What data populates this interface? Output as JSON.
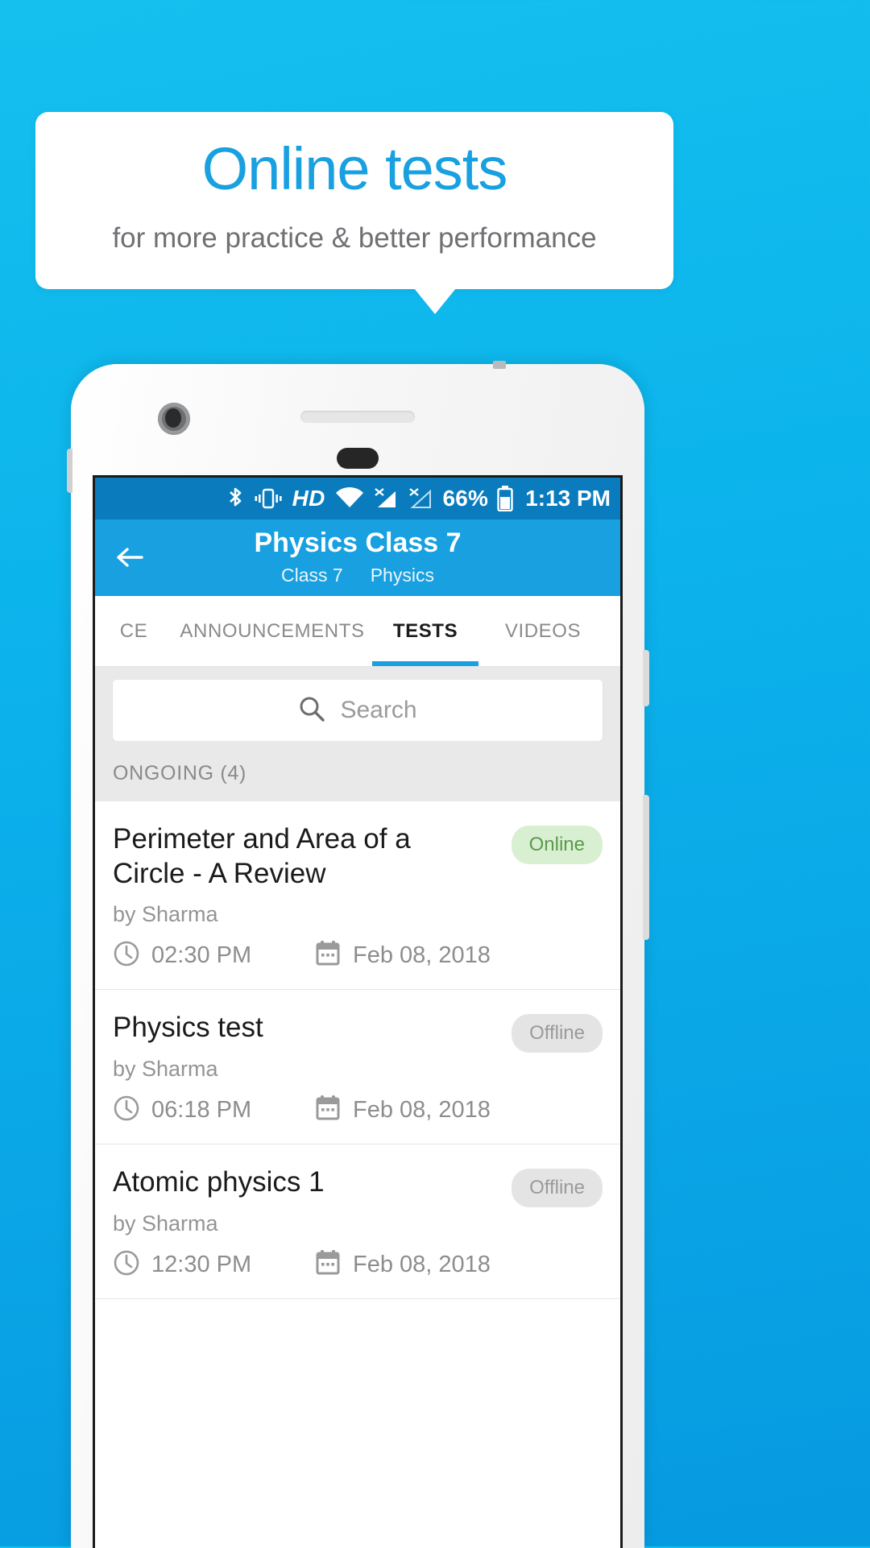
{
  "banner": {
    "title": "Online tests",
    "subtitle": "for more practice & better performance",
    "title_color": "#18a0e0",
    "subtitle_color": "#6e7073",
    "background_color": "#ffffff"
  },
  "background_color": "#0cb4ec",
  "statusbar": {
    "icons": [
      "bluetooth-icon",
      "vibrate-icon",
      "hd-icon",
      "wifi-icon",
      "signal-no-service-icon",
      "signal-no-service-2-icon"
    ],
    "battery_percent": "66%",
    "battery_icon": "battery-icon",
    "time": "1:13 PM",
    "background_color": "#0a7cbd"
  },
  "appbar": {
    "back_icon": "back-arrow-icon",
    "title": "Physics Class 7",
    "subtitle_class": "Class 7",
    "subtitle_subject": "Physics",
    "background_color": "#18a0e0"
  },
  "tabs": [
    {
      "label": "CE",
      "active": false
    },
    {
      "label": "ANNOUNCEMENTS",
      "active": false
    },
    {
      "label": "TESTS",
      "active": true
    },
    {
      "label": "VIDEOS",
      "active": false
    }
  ],
  "tab_indicator_color": "#18a0e0",
  "search": {
    "icon": "search-icon",
    "placeholder": "Search",
    "value": ""
  },
  "section": {
    "label": "ONGOING (4)"
  },
  "tests": [
    {
      "title": "Perimeter and Area of a Circle - A Review",
      "author": "by Sharma",
      "time": "02:30 PM",
      "date": "Feb 08, 2018",
      "status": "Online",
      "status_type": "online"
    },
    {
      "title": "Physics test",
      "author": "by Sharma",
      "time": "06:18 PM",
      "date": "Feb 08, 2018",
      "status": "Offline",
      "status_type": "offline"
    },
    {
      "title": "Atomic physics 1",
      "author": "by Sharma",
      "time": "12:30 PM",
      "date": "Feb 08, 2018",
      "status": "Offline",
      "status_type": "offline"
    }
  ],
  "icons": {
    "clock": "clock-icon",
    "calendar": "calendar-icon"
  },
  "badge_colors": {
    "online_bg": "#d9efd2",
    "online_text": "#5a9a4a",
    "offline_bg": "#e4e4e4",
    "offline_text": "#9a9a9a"
  }
}
